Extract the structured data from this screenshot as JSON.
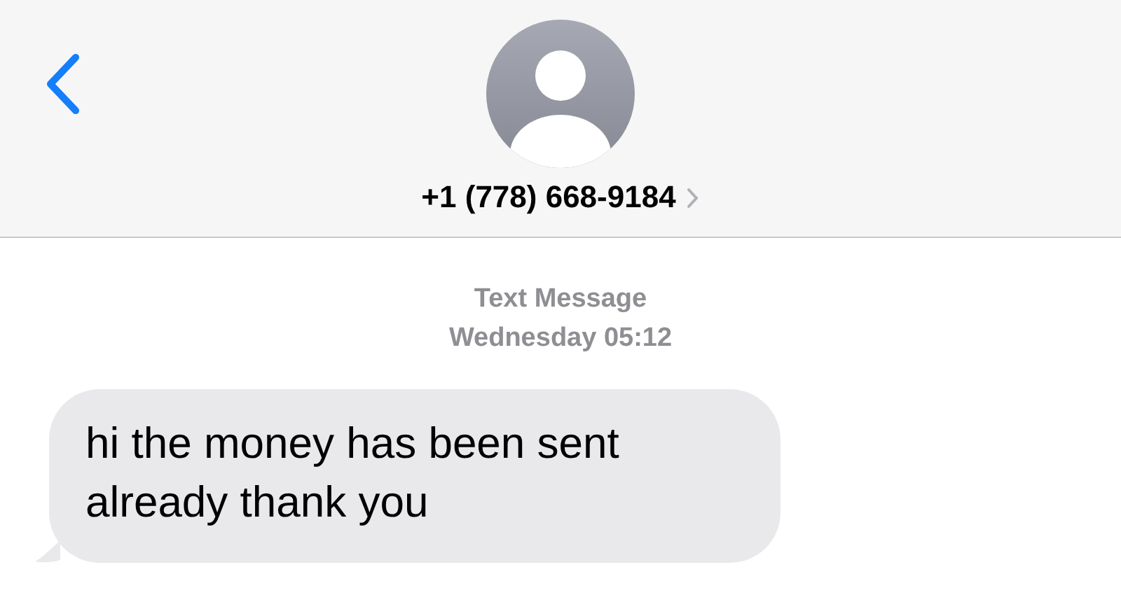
{
  "header": {
    "contact": "+1 (778) 668-9184"
  },
  "timestamp": {
    "service": "Text Message",
    "time": "Wednesday 05:12"
  },
  "messages": [
    {
      "text": "hi the money has been sent already thank you"
    }
  ]
}
